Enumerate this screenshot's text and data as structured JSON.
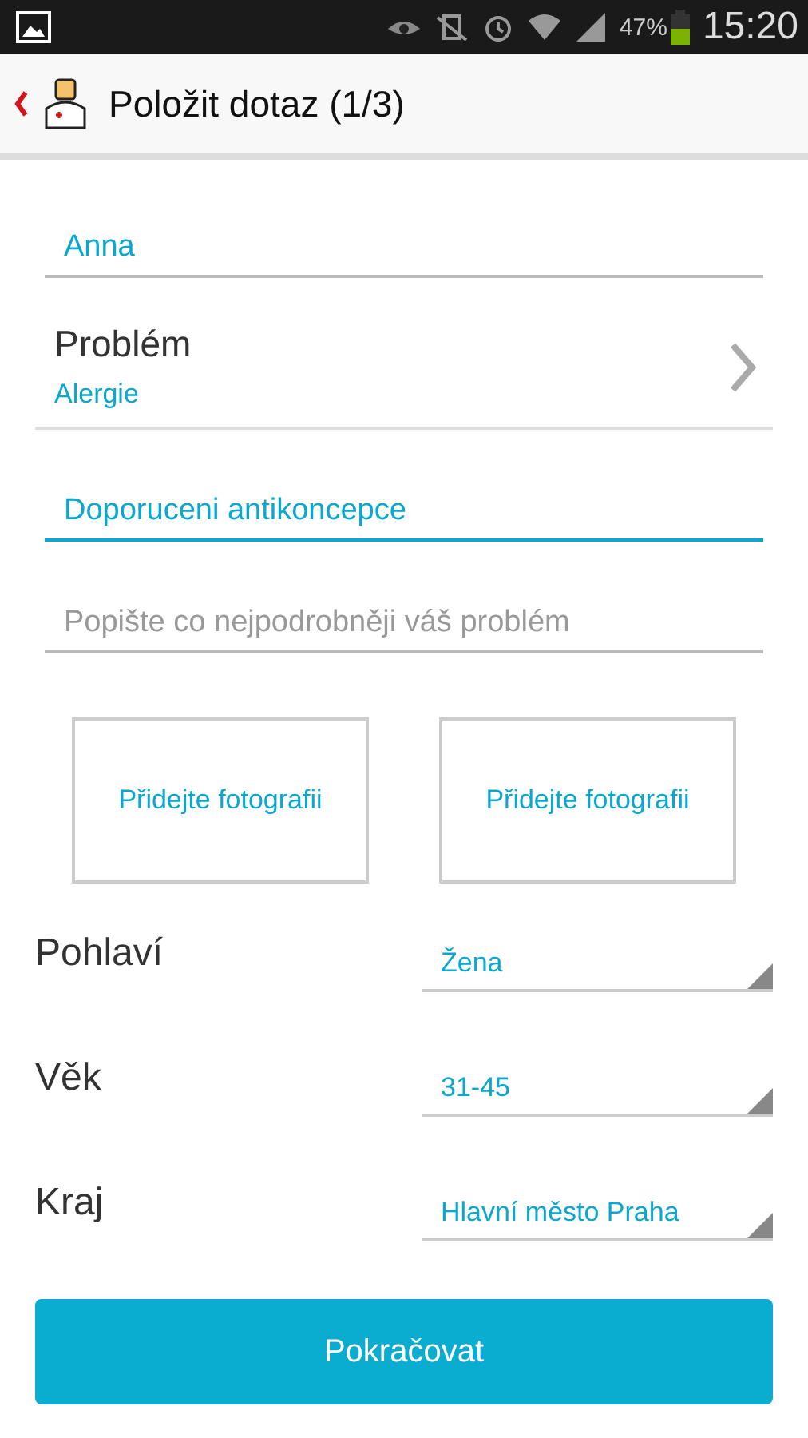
{
  "status_bar": {
    "battery": "47%",
    "time": "15:20"
  },
  "header": {
    "title": "Položit dotaz (1/3)"
  },
  "fields": [
    {
      "kind": "input",
      "value": "Anna",
      "focused": false
    },
    {
      "kind": "picker",
      "label": "Problém",
      "value": "Alergie"
    },
    {
      "kind": "input",
      "value": "Doporuceni antikoncepce",
      "focused": true
    },
    {
      "kind": "input",
      "placeholder": "Popište co nejpodrobněji váš problém",
      "focused": false
    }
  ],
  "photos": [
    "Přidejte fotografii",
    "Přidejte fotografii"
  ],
  "selects": [
    {
      "label": "Pohlaví",
      "value": "Žena"
    },
    {
      "label": "Věk",
      "value": "31-45"
    },
    {
      "label": "Kraj",
      "value": "Hlavní město Praha"
    }
  ],
  "continue_button": "Pokračovat"
}
